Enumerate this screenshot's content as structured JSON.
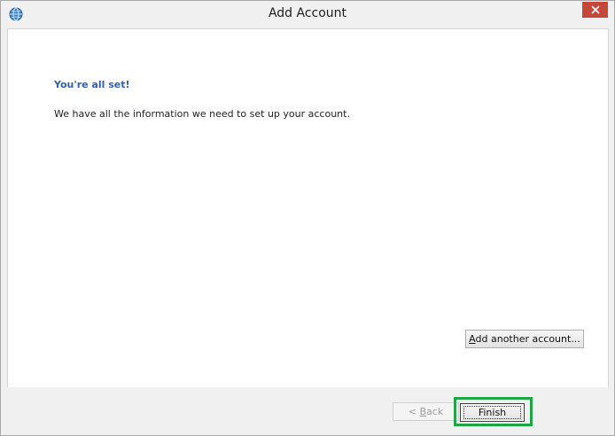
{
  "window": {
    "title": "Add Account",
    "close_glyph": "✕",
    "accent_close": "#c7463a"
  },
  "content": {
    "heading": "You're all set!",
    "message": "We have all the information we need to set up your account.",
    "add_another_access_key": "A",
    "add_another_rest": "dd another account..."
  },
  "footer": {
    "back_prefix": "< ",
    "back_access_key": "B",
    "back_rest": "ack",
    "finish_label": "Finish",
    "highlight_color": "#1ea544"
  },
  "icons": {
    "app": "globe-icon",
    "close": "close-icon"
  }
}
